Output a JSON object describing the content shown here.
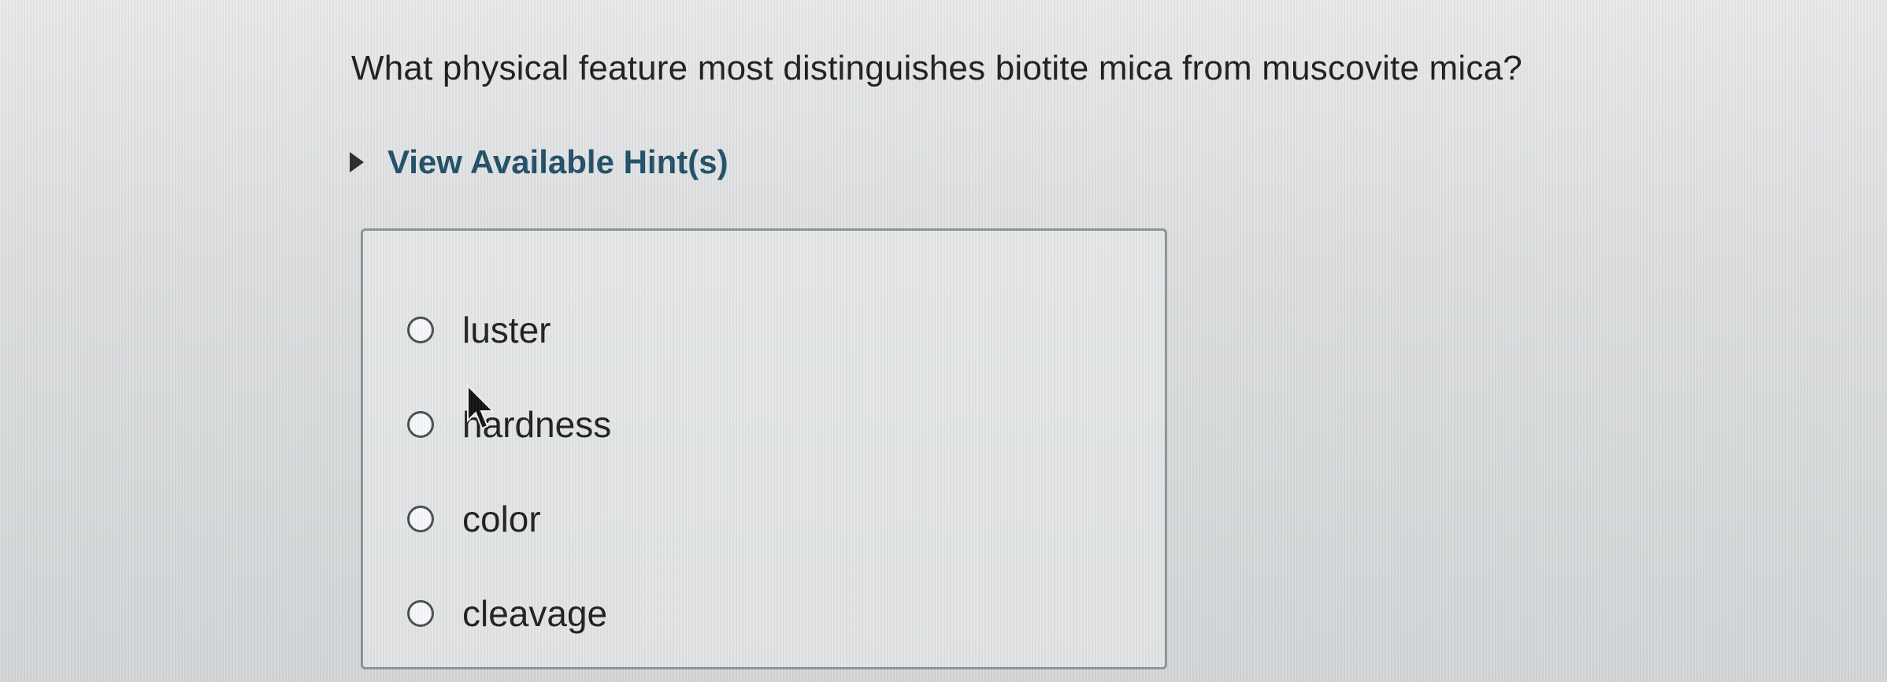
{
  "question": {
    "text": "What physical feature most distinguishes biotite mica from muscovite mica?"
  },
  "hint": {
    "label": "View Available Hint(s)",
    "icon": "triangle-right-icon"
  },
  "options": [
    {
      "label": "luster",
      "selected": false
    },
    {
      "label": "hardness",
      "selected": false
    },
    {
      "label": "color",
      "selected": false
    },
    {
      "label": "cleavage",
      "selected": false
    }
  ],
  "colors": {
    "hint_link": "#1f4f66",
    "question_text": "#1d1d1f",
    "box_border": "#8e9396"
  }
}
